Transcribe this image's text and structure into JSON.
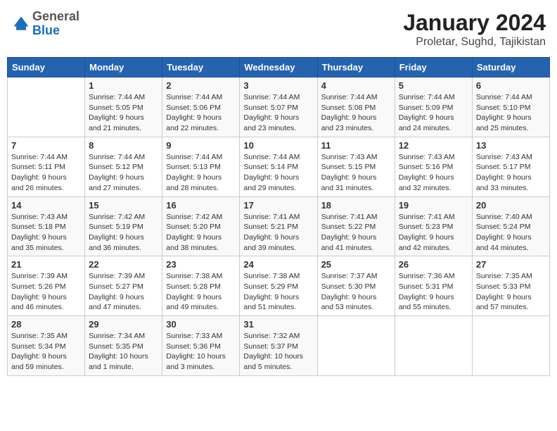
{
  "header": {
    "logo_general": "General",
    "logo_blue": "Blue",
    "title": "January 2024",
    "subtitle": "Proletar, Sughd, Tajikistan"
  },
  "calendar": {
    "days_of_week": [
      "Sunday",
      "Monday",
      "Tuesday",
      "Wednesday",
      "Thursday",
      "Friday",
      "Saturday"
    ],
    "weeks": [
      [
        {
          "day": "",
          "info": ""
        },
        {
          "day": "1",
          "info": "Sunrise: 7:44 AM\nSunset: 5:05 PM\nDaylight: 9 hours\nand 21 minutes."
        },
        {
          "day": "2",
          "info": "Sunrise: 7:44 AM\nSunset: 5:06 PM\nDaylight: 9 hours\nand 22 minutes."
        },
        {
          "day": "3",
          "info": "Sunrise: 7:44 AM\nSunset: 5:07 PM\nDaylight: 9 hours\nand 23 minutes."
        },
        {
          "day": "4",
          "info": "Sunrise: 7:44 AM\nSunset: 5:08 PM\nDaylight: 9 hours\nand 23 minutes."
        },
        {
          "day": "5",
          "info": "Sunrise: 7:44 AM\nSunset: 5:09 PM\nDaylight: 9 hours\nand 24 minutes."
        },
        {
          "day": "6",
          "info": "Sunrise: 7:44 AM\nSunset: 5:10 PM\nDaylight: 9 hours\nand 25 minutes."
        }
      ],
      [
        {
          "day": "7",
          "info": "Sunrise: 7:44 AM\nSunset: 5:11 PM\nDaylight: 9 hours\nand 26 minutes."
        },
        {
          "day": "8",
          "info": "Sunrise: 7:44 AM\nSunset: 5:12 PM\nDaylight: 9 hours\nand 27 minutes."
        },
        {
          "day": "9",
          "info": "Sunrise: 7:44 AM\nSunset: 5:13 PM\nDaylight: 9 hours\nand 28 minutes."
        },
        {
          "day": "10",
          "info": "Sunrise: 7:44 AM\nSunset: 5:14 PM\nDaylight: 9 hours\nand 29 minutes."
        },
        {
          "day": "11",
          "info": "Sunrise: 7:43 AM\nSunset: 5:15 PM\nDaylight: 9 hours\nand 31 minutes."
        },
        {
          "day": "12",
          "info": "Sunrise: 7:43 AM\nSunset: 5:16 PM\nDaylight: 9 hours\nand 32 minutes."
        },
        {
          "day": "13",
          "info": "Sunrise: 7:43 AM\nSunset: 5:17 PM\nDaylight: 9 hours\nand 33 minutes."
        }
      ],
      [
        {
          "day": "14",
          "info": "Sunrise: 7:43 AM\nSunset: 5:18 PM\nDaylight: 9 hours\nand 35 minutes."
        },
        {
          "day": "15",
          "info": "Sunrise: 7:42 AM\nSunset: 5:19 PM\nDaylight: 9 hours\nand 36 minutes."
        },
        {
          "day": "16",
          "info": "Sunrise: 7:42 AM\nSunset: 5:20 PM\nDaylight: 9 hours\nand 38 minutes."
        },
        {
          "day": "17",
          "info": "Sunrise: 7:41 AM\nSunset: 5:21 PM\nDaylight: 9 hours\nand 39 minutes."
        },
        {
          "day": "18",
          "info": "Sunrise: 7:41 AM\nSunset: 5:22 PM\nDaylight: 9 hours\nand 41 minutes."
        },
        {
          "day": "19",
          "info": "Sunrise: 7:41 AM\nSunset: 5:23 PM\nDaylight: 9 hours\nand 42 minutes."
        },
        {
          "day": "20",
          "info": "Sunrise: 7:40 AM\nSunset: 5:24 PM\nDaylight: 9 hours\nand 44 minutes."
        }
      ],
      [
        {
          "day": "21",
          "info": "Sunrise: 7:39 AM\nSunset: 5:26 PM\nDaylight: 9 hours\nand 46 minutes."
        },
        {
          "day": "22",
          "info": "Sunrise: 7:39 AM\nSunset: 5:27 PM\nDaylight: 9 hours\nand 47 minutes."
        },
        {
          "day": "23",
          "info": "Sunrise: 7:38 AM\nSunset: 5:28 PM\nDaylight: 9 hours\nand 49 minutes."
        },
        {
          "day": "24",
          "info": "Sunrise: 7:38 AM\nSunset: 5:29 PM\nDaylight: 9 hours\nand 51 minutes."
        },
        {
          "day": "25",
          "info": "Sunrise: 7:37 AM\nSunset: 5:30 PM\nDaylight: 9 hours\nand 53 minutes."
        },
        {
          "day": "26",
          "info": "Sunrise: 7:36 AM\nSunset: 5:31 PM\nDaylight: 9 hours\nand 55 minutes."
        },
        {
          "day": "27",
          "info": "Sunrise: 7:35 AM\nSunset: 5:33 PM\nDaylight: 9 hours\nand 57 minutes."
        }
      ],
      [
        {
          "day": "28",
          "info": "Sunrise: 7:35 AM\nSunset: 5:34 PM\nDaylight: 9 hours\nand 59 minutes."
        },
        {
          "day": "29",
          "info": "Sunrise: 7:34 AM\nSunset: 5:35 PM\nDaylight: 10 hours\nand 1 minute."
        },
        {
          "day": "30",
          "info": "Sunrise: 7:33 AM\nSunset: 5:36 PM\nDaylight: 10 hours\nand 3 minutes."
        },
        {
          "day": "31",
          "info": "Sunrise: 7:32 AM\nSunset: 5:37 PM\nDaylight: 10 hours\nand 5 minutes."
        },
        {
          "day": "",
          "info": ""
        },
        {
          "day": "",
          "info": ""
        },
        {
          "day": "",
          "info": ""
        }
      ]
    ]
  }
}
